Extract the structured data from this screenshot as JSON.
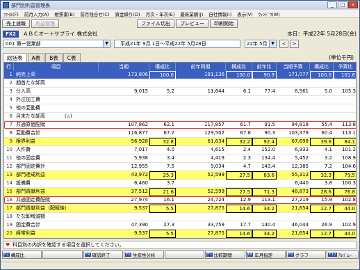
{
  "window": {
    "title": "部門別利益管理表",
    "controls": [
      "_",
      "□",
      "×"
    ]
  },
  "menu": [
    "ﾌｧｲﾙ(F)",
    "前月入力(A)",
    "帳票書(B)",
    "前月残合せ(C)",
    "資金繰り(D)",
    "月次・年次(E)",
    "最新業績(J)",
    "自社情報(I)",
    "表示(V)",
    "ｳｨﾝﾄﾞｳ(W)"
  ],
  "toolbar": {
    "buttons": [
      "売上速報",
      "利益管理"
    ],
    "right_buttons": [
      "ファイル切出",
      "プレビュー",
      "印刷開始"
    ]
  },
  "company": {
    "badge": "FX2",
    "name": "ＡＢＣオートサプライ 株式会社",
    "right": "本日：平成22年 5月28日(金)"
  },
  "filter": {
    "department": "001 第一営業部",
    "period": "平成21年 9月 1日〜平成22年 5月28日",
    "month": "22年 5月",
    "prev": "<",
    "next": ">"
  },
  "tabs": [
    "総括表",
    "A表",
    "B表",
    "C表"
  ],
  "unit": "(単位千円)",
  "columns": [
    "行",
    "項目",
    "当期",
    "構成比",
    "前年同期",
    "構成比",
    "前年比",
    "当期予算",
    "構成比",
    "予算比"
  ],
  "rows": [
    {
      "no": "1",
      "name": "純売上高",
      "cur": "173,806",
      "r1": "100.0",
      "prev": "191,136",
      "r2": "100.0",
      "yoy": "90.9",
      "bud": "171,077",
      "r3": "100.0",
      "br": "101.6",
      "style": "blue"
    },
    {
      "no": "2",
      "name": "期首たな卸高",
      "cur": "",
      "r1": "",
      "prev": "",
      "r2": "",
      "yoy": "",
      "bud": "",
      "r3": "",
      "br": "",
      "style": ""
    },
    {
      "no": "3",
      "name": "仕入高",
      "cur": "9,015",
      "r1": "5.2",
      "prev": "11,644",
      "r2": "6.1",
      "yoy": "77.4",
      "bud": "8,561",
      "r3": "5.0",
      "br": "105.3",
      "style": ""
    },
    {
      "no": "4",
      "name": "外注加工費",
      "cur": "",
      "r1": "",
      "prev": "",
      "r2": "",
      "yoy": "",
      "bud": "",
      "r3": "",
      "br": "",
      "style": ""
    },
    {
      "no": "5",
      "name": "他の変動費",
      "cur": "",
      "r1": "",
      "prev": "",
      "r2": "",
      "yoy": "",
      "bud": "",
      "r3": "",
      "br": "",
      "style": ""
    },
    {
      "no": "6",
      "name": "月末たな卸高　　　　(△)",
      "cur": "",
      "r1": "",
      "prev": "",
      "r2": "",
      "yoy": "",
      "bud": "",
      "r3": "",
      "br": "",
      "style": ""
    },
    {
      "no": "7",
      "name": "共通原価配賦",
      "cur": "107,862",
      "r1": "62.1",
      "prev": "117,857",
      "r2": "61.7",
      "yoy": "91.5",
      "bud": "94,818",
      "r3": "55.4",
      "br": "113.8",
      "style": ""
    },
    {
      "no": "8",
      "name": "変動費合計",
      "cur": "116,877",
      "r1": "67.2",
      "prev": "129,502",
      "r2": "67.8",
      "yoy": "90.3",
      "bud": "103,379",
      "r3": "60.4",
      "br": "113.1",
      "style": ""
    },
    {
      "no": "9",
      "name": "限界利益",
      "cur": "56,928",
      "r1": "32.8",
      "prev": "61,634",
      "r2": "32.2",
      "yoy": "92.4",
      "bud": "67,698",
      "r3": "39.6",
      "br": "84.1",
      "style": "yellow"
    },
    {
      "no": "10",
      "name": "人件費",
      "cur": "7,017",
      "r1": "4.0",
      "prev": "4,615",
      "r2": "2.4",
      "yoy": "152.0",
      "bud": "6,933",
      "r3": "4.1",
      "br": "101.2",
      "style": ""
    },
    {
      "no": "11",
      "name": "他の固定費",
      "cur": "5,938",
      "r1": "3.4",
      "prev": "4,419",
      "r2": "2.3",
      "yoy": "134.4",
      "bud": "5,452",
      "r3": "3.2",
      "br": "108.9",
      "style": ""
    },
    {
      "no": "12",
      "name": "部門固定費計",
      "cur": "12,955",
      "r1": "7.5",
      "prev": "9,034",
      "r2": "4.7",
      "yoy": "143.4",
      "bud": "12,385",
      "r3": "7.2",
      "br": "104.6",
      "style": ""
    },
    {
      "no": "13",
      "name": "部門達成利益",
      "cur": "43,972",
      "r1": "25.3",
      "prev": "52,599",
      "r2": "27.5",
      "yoy": "83.6",
      "bud": "55,313",
      "r3": "32.3",
      "br": "79.5",
      "style": "yellow"
    },
    {
      "no": "14",
      "name": "設備費",
      "cur": "6,460",
      "r1": "3.7",
      "prev": "",
      "r2": "",
      "yoy": "",
      "bud": "6,440",
      "r3": "3.8",
      "br": "100.3",
      "style": ""
    },
    {
      "no": "15",
      "name": "部門貢献利益",
      "cur": "37,512",
      "r1": "21.6",
      "prev": "52,599",
      "r2": "27.5",
      "yoy": "71.3",
      "bud": "48,873",
      "r3": "28.6",
      "br": "76.8",
      "style": "yellow"
    },
    {
      "no": "16",
      "name": "共通固定費配賦",
      "cur": "27,974",
      "r1": "16.1",
      "prev": "24,724",
      "r2": "12.9",
      "yoy": "113.1",
      "bud": "27,219",
      "r3": "15.9",
      "br": "102.8",
      "style": ""
    },
    {
      "no": "17",
      "name": "部門貢献利益（配賦後）",
      "cur": "9,537",
      "r1": "5.5",
      "prev": "27,875",
      "r2": "14.6",
      "yoy": "34.2",
      "bud": "21,654",
      "r3": "12.7",
      "br": "44.0",
      "style": "yellow"
    },
    {
      "no": "18",
      "name": "たな卸増減額",
      "cur": "",
      "r1": "",
      "prev": "",
      "r2": "",
      "yoy": "",
      "bud": "",
      "r3": "",
      "br": "",
      "style": ""
    },
    {
      "no": "19",
      "name": "固定費合計",
      "cur": "47,390",
      "r1": "27.3",
      "prev": "33,759",
      "r2": "17.7",
      "yoy": "140.4",
      "bud": "46,044",
      "r3": "26.9",
      "br": "102.9",
      "style": ""
    },
    {
      "no": "20",
      "name": "経常利益",
      "cur": "9,537",
      "r1": "5.5",
      "prev": "27,875",
      "r2": "14.6",
      "yoy": "34.2",
      "bud": "21,654",
      "r3": "12.7",
      "br": "44.0",
      "style": "yellow"
    }
  ],
  "hint": "科目別の内訳を確認する項目を選択してください。",
  "fkeys": [
    {
      "key": "F2",
      "label": "構成比"
    },
    {
      "key": "",
      "label": ""
    },
    {
      "key": "F4",
      "label": "確認終了"
    },
    {
      "key": "F5",
      "label": "生産性分析"
    },
    {
      "key": "",
      "label": ""
    },
    {
      "key": "F7",
      "label": "比較期間"
    },
    {
      "key": "F8",
      "label": "年月指定"
    },
    {
      "key": "F9",
      "label": "グラフ"
    },
    {
      "key": "F10",
      "label": "ｱﾙﾊﾞﾑｰ"
    }
  ],
  "highlighted_rows": [
    "7",
    "16"
  ]
}
